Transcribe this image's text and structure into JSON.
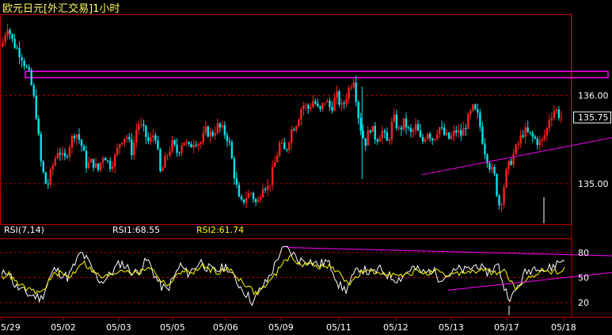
{
  "header": {
    "title": "欧元日元[外汇交易]1小时"
  },
  "colors": {
    "up": "#ff2020",
    "down": "#00e5ee",
    "grid": "#b00000",
    "frame": "#c00000",
    "trend": "#ff00ff",
    "rsi1": "#ffffff",
    "rsi2": "#ffff00",
    "label_red": "#ff4040",
    "label_white": "#ffffff",
    "label_yellow": "#ffff00"
  },
  "indicator": {
    "name": "RSI(7,14)",
    "rsi1_label": "RSI1:68.55",
    "rsi2_label": "RSI2:61.74"
  },
  "chart_data": [
    {
      "type": "candlestick",
      "title": "欧元日元[外汇交易]1小时",
      "yticks": [
        "135.75",
        "136.00",
        "135.00"
      ],
      "ylim": [
        134.55,
        136.9
      ],
      "x_labels": [
        "5/29",
        "05/02",
        "05/03",
        "05/05",
        "05/06",
        "05/09",
        "05/11",
        "05/12",
        "05/13",
        "05/17",
        "05/18"
      ],
      "grid": true,
      "support_trend": {
        "from": [
          135.1,
          0.74
        ],
        "to": [
          135.52,
          1.0
        ]
      },
      "resistance_band": [
        136.2,
        136.27
      ],
      "path": [
        [
          0.0,
          136.55
        ],
        [
          0.01,
          136.8
        ],
        [
          0.02,
          136.6
        ],
        [
          0.035,
          136.45
        ],
        [
          0.05,
          136.2
        ],
        [
          0.06,
          135.85
        ],
        [
          0.07,
          135.2
        ],
        [
          0.08,
          134.95
        ],
        [
          0.09,
          135.2
        ],
        [
          0.1,
          135.4
        ],
        [
          0.11,
          135.25
        ],
        [
          0.12,
          135.45
        ],
        [
          0.13,
          135.6
        ],
        [
          0.14,
          135.45
        ],
        [
          0.15,
          135.2
        ],
        [
          0.16,
          135.25
        ],
        [
          0.17,
          135.15
        ],
        [
          0.18,
          135.35
        ],
        [
          0.19,
          135.2
        ],
        [
          0.2,
          135.3
        ],
        [
          0.21,
          135.5
        ],
        [
          0.22,
          135.55
        ],
        [
          0.23,
          135.35
        ],
        [
          0.24,
          135.7
        ],
        [
          0.25,
          135.6
        ],
        [
          0.26,
          135.45
        ],
        [
          0.27,
          135.6
        ],
        [
          0.28,
          135.1
        ],
        [
          0.29,
          135.3
        ],
        [
          0.3,
          135.45
        ],
        [
          0.31,
          135.35
        ],
        [
          0.32,
          135.5
        ],
        [
          0.33,
          135.4
        ],
        [
          0.34,
          135.5
        ],
        [
          0.35,
          135.45
        ],
        [
          0.36,
          135.6
        ],
        [
          0.37,
          135.55
        ],
        [
          0.38,
          135.65
        ],
        [
          0.39,
          135.6
        ],
        [
          0.4,
          135.5
        ],
        [
          0.41,
          135.1
        ],
        [
          0.42,
          134.75
        ],
        [
          0.43,
          134.85
        ],
        [
          0.44,
          134.9
        ],
        [
          0.45,
          134.75
        ],
        [
          0.46,
          135.0
        ],
        [
          0.47,
          134.95
        ],
        [
          0.48,
          135.2
        ],
        [
          0.49,
          135.45
        ],
        [
          0.5,
          135.35
        ],
        [
          0.51,
          135.6
        ],
        [
          0.52,
          135.7
        ],
        [
          0.53,
          135.9
        ],
        [
          0.54,
          135.85
        ],
        [
          0.55,
          135.95
        ],
        [
          0.56,
          135.8
        ],
        [
          0.57,
          135.95
        ],
        [
          0.58,
          135.85
        ],
        [
          0.59,
          136.0
        ],
        [
          0.6,
          135.85
        ],
        [
          0.61,
          136.05
        ],
        [
          0.62,
          136.2
        ],
        [
          0.63,
          135.7
        ],
        [
          0.64,
          135.45
        ],
        [
          0.65,
          135.65
        ],
        [
          0.66,
          135.5
        ],
        [
          0.67,
          135.6
        ],
        [
          0.68,
          135.45
        ],
        [
          0.69,
          135.75
        ],
        [
          0.7,
          135.6
        ],
        [
          0.71,
          135.7
        ],
        [
          0.72,
          135.55
        ],
        [
          0.73,
          135.65
        ],
        [
          0.74,
          135.45
        ],
        [
          0.75,
          135.6
        ],
        [
          0.76,
          135.5
        ],
        [
          0.77,
          135.65
        ],
        [
          0.78,
          135.55
        ],
        [
          0.79,
          135.5
        ],
        [
          0.8,
          135.6
        ],
        [
          0.81,
          135.55
        ],
        [
          0.82,
          135.7
        ],
        [
          0.83,
          135.85
        ],
        [
          0.84,
          135.75
        ],
        [
          0.85,
          135.4
        ],
        [
          0.86,
          135.2
        ],
        [
          0.87,
          135.05
        ],
        [
          0.875,
          134.75
        ],
        [
          0.88,
          134.8
        ],
        [
          0.89,
          135.15
        ],
        [
          0.9,
          135.3
        ],
        [
          0.91,
          135.45
        ],
        [
          0.92,
          135.6
        ],
        [
          0.93,
          135.55
        ],
        [
          0.94,
          135.5
        ],
        [
          0.95,
          135.45
        ],
        [
          0.96,
          135.6
        ],
        [
          0.965,
          135.75
        ],
        [
          0.975,
          135.85
        ],
        [
          0.985,
          135.75
        ]
      ]
    },
    {
      "type": "line",
      "title": "RSI(7,14)",
      "yticks": [
        "80",
        "50",
        "20"
      ],
      "ylim": [
        5,
        95
      ],
      "series": [
        {
          "name": "RSI1",
          "values": [
            52,
            60,
            40,
            35,
            30,
            28,
            25,
            45,
            60,
            55,
            50,
            65,
            80,
            70,
            55,
            45,
            50,
            60,
            68,
            62,
            55,
            60,
            72,
            55,
            40,
            35,
            50,
            65,
            55,
            60,
            70,
            62,
            58,
            60,
            64,
            50,
            40,
            30,
            20,
            35,
            45,
            60,
            80,
            85,
            78,
            70,
            72,
            68,
            65,
            70,
            60,
            40,
            35,
            50,
            62,
            58,
            55,
            60,
            55,
            50,
            48,
            55,
            62,
            58,
            55,
            60,
            50,
            52,
            55,
            60,
            58,
            62,
            66,
            55,
            60,
            65,
            35,
            25,
            40,
            55,
            60,
            65,
            58,
            62,
            68,
            72
          ]
        },
        {
          "name": "RSI2",
          "values": [
            50,
            55,
            45,
            40,
            35,
            33,
            32,
            45,
            55,
            55,
            50,
            58,
            70,
            62,
            55,
            50,
            52,
            56,
            60,
            58,
            55,
            58,
            64,
            55,
            45,
            42,
            50,
            60,
            55,
            58,
            64,
            60,
            57,
            58,
            60,
            52,
            45,
            38,
            30,
            38,
            45,
            55,
            70,
            74,
            70,
            65,
            66,
            64,
            62,
            64,
            58,
            48,
            44,
            50,
            58,
            56,
            55,
            57,
            55,
            52,
            51,
            55,
            58,
            56,
            55,
            57,
            52,
            53,
            55,
            57,
            56,
            58,
            60,
            55,
            57,
            58,
            45,
            35,
            42,
            52,
            56,
            60,
            56,
            58,
            62
          ]
        }
      ],
      "upper_trend": [
        86,
        76
      ],
      "lower_trend": [
        35,
        56
      ]
    }
  ]
}
